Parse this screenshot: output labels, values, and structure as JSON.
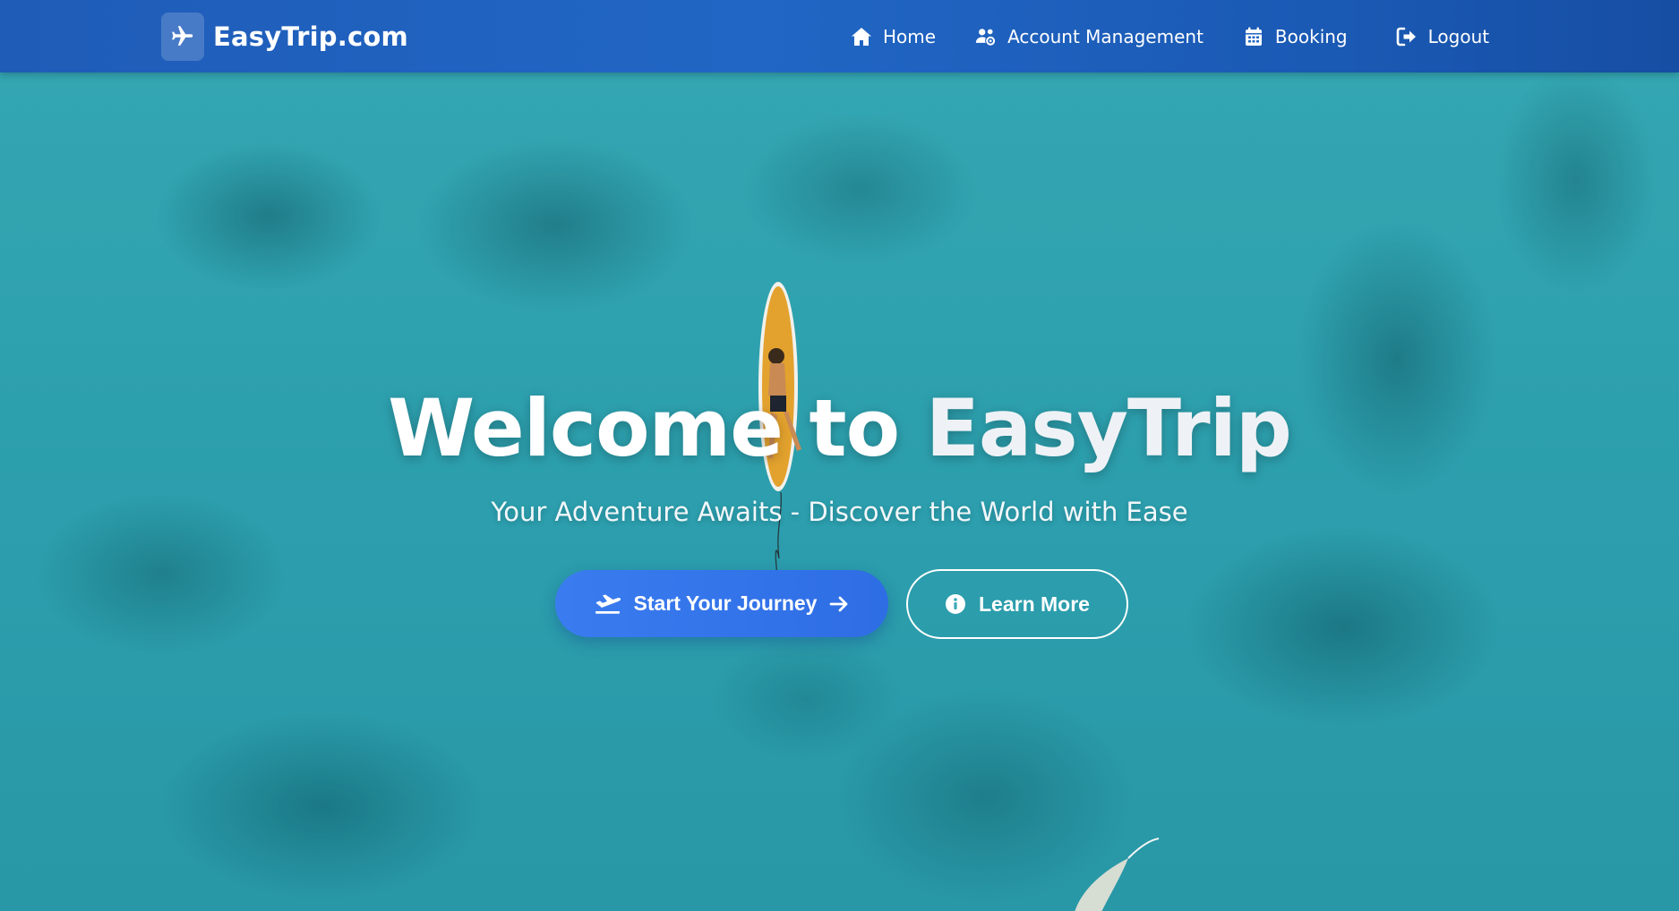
{
  "navbar": {
    "brand": "EasyTrip.com",
    "brand_icon": "plane-icon",
    "links": [
      {
        "label": "Home",
        "icon": "home-icon"
      },
      {
        "label": "Account Management",
        "icon": "users-cog-icon"
      },
      {
        "label": "Booking",
        "icon": "calendar-icon"
      },
      {
        "label": "Logout",
        "icon": "sign-out-icon"
      }
    ]
  },
  "hero": {
    "title_main": "Welcome to ",
    "title_accent": "EasyTrip",
    "subtitle": "Your Adventure Awaits - Discover the World with Ease",
    "primary_button": {
      "label": "Start Your Journey",
      "icon": "plane-departure-icon",
      "trailing_icon": "arrow-right-icon"
    },
    "secondary_button": {
      "label": "Learn More",
      "icon": "info-circle-icon"
    }
  },
  "colors": {
    "navbar": "#2166c4",
    "primary_button": "#3a7cf0",
    "water": "#34b1bf",
    "text": "#ffffff"
  }
}
